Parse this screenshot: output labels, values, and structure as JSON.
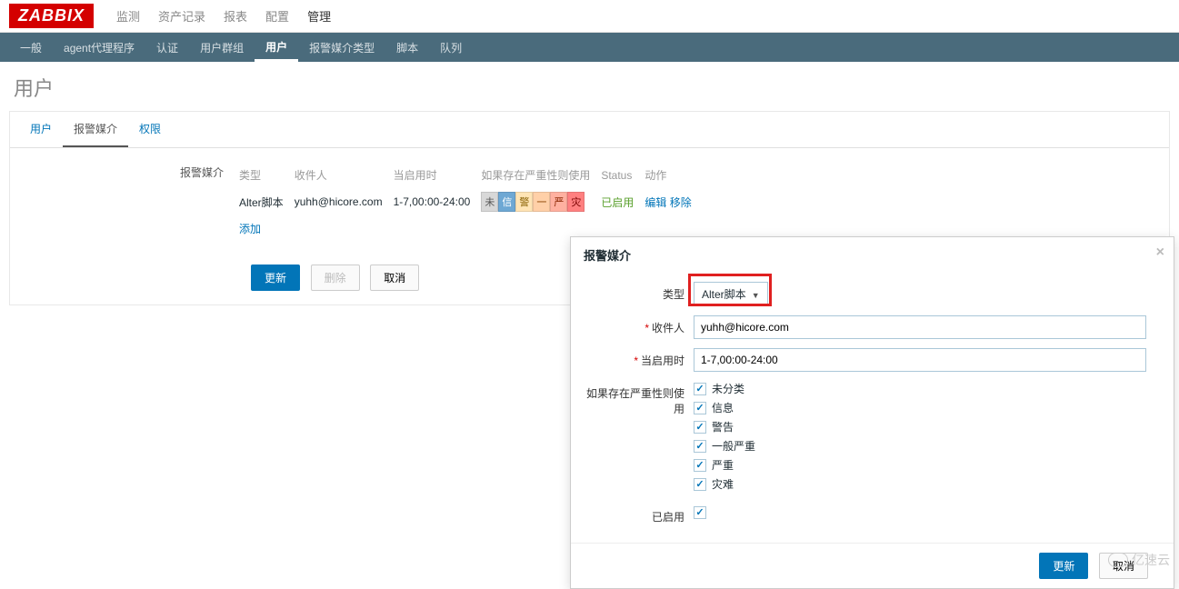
{
  "logo": "ZABBIX",
  "topnav": {
    "items": [
      "监测",
      "资产记录",
      "报表",
      "配置",
      "管理"
    ],
    "active_index": 4
  },
  "subnav": {
    "items": [
      "一般",
      "agent代理程序",
      "认证",
      "用户群组",
      "用户",
      "报警媒介类型",
      "脚本",
      "队列"
    ],
    "active_index": 4
  },
  "page_title": "用户",
  "tabs": {
    "items": [
      "用户",
      "报警媒介",
      "权限"
    ],
    "active_index": 1
  },
  "media_section": {
    "label": "报警媒介",
    "headers": [
      "类型",
      "收件人",
      "当启用时",
      "如果存在严重性则使用",
      "Status",
      "动作"
    ],
    "row": {
      "type": "Alter脚本",
      "sendto": "yuhh@hicore.com",
      "when": "1-7,00:00-24:00",
      "severities": [
        "未",
        "信",
        "警",
        "一",
        "严",
        "灾"
      ],
      "status": "已启用",
      "actions": [
        "编辑",
        "移除"
      ]
    },
    "add_link": "添加"
  },
  "buttons": {
    "update": "更新",
    "delete": "删除",
    "cancel": "取消"
  },
  "modal": {
    "title": "报警媒介",
    "fields": {
      "type_label": "类型",
      "type_value": "Alter脚本",
      "sendto_label": "收件人",
      "sendto_value": "yuhh@hicore.com",
      "when_label": "当启用时",
      "when_value": "1-7,00:00-24:00",
      "severity_label": "如果存在严重性则使用",
      "severities": [
        {
          "label": "未分类",
          "checked": true
        },
        {
          "label": "信息",
          "checked": true
        },
        {
          "label": "警告",
          "checked": true
        },
        {
          "label": "一般严重",
          "checked": true
        },
        {
          "label": "严重",
          "checked": true
        },
        {
          "label": "灾难",
          "checked": true
        }
      ],
      "enabled_label": "已启用",
      "enabled_checked": true
    },
    "footer": {
      "update": "更新",
      "cancel": "取消"
    }
  },
  "watermark": "亿速云"
}
